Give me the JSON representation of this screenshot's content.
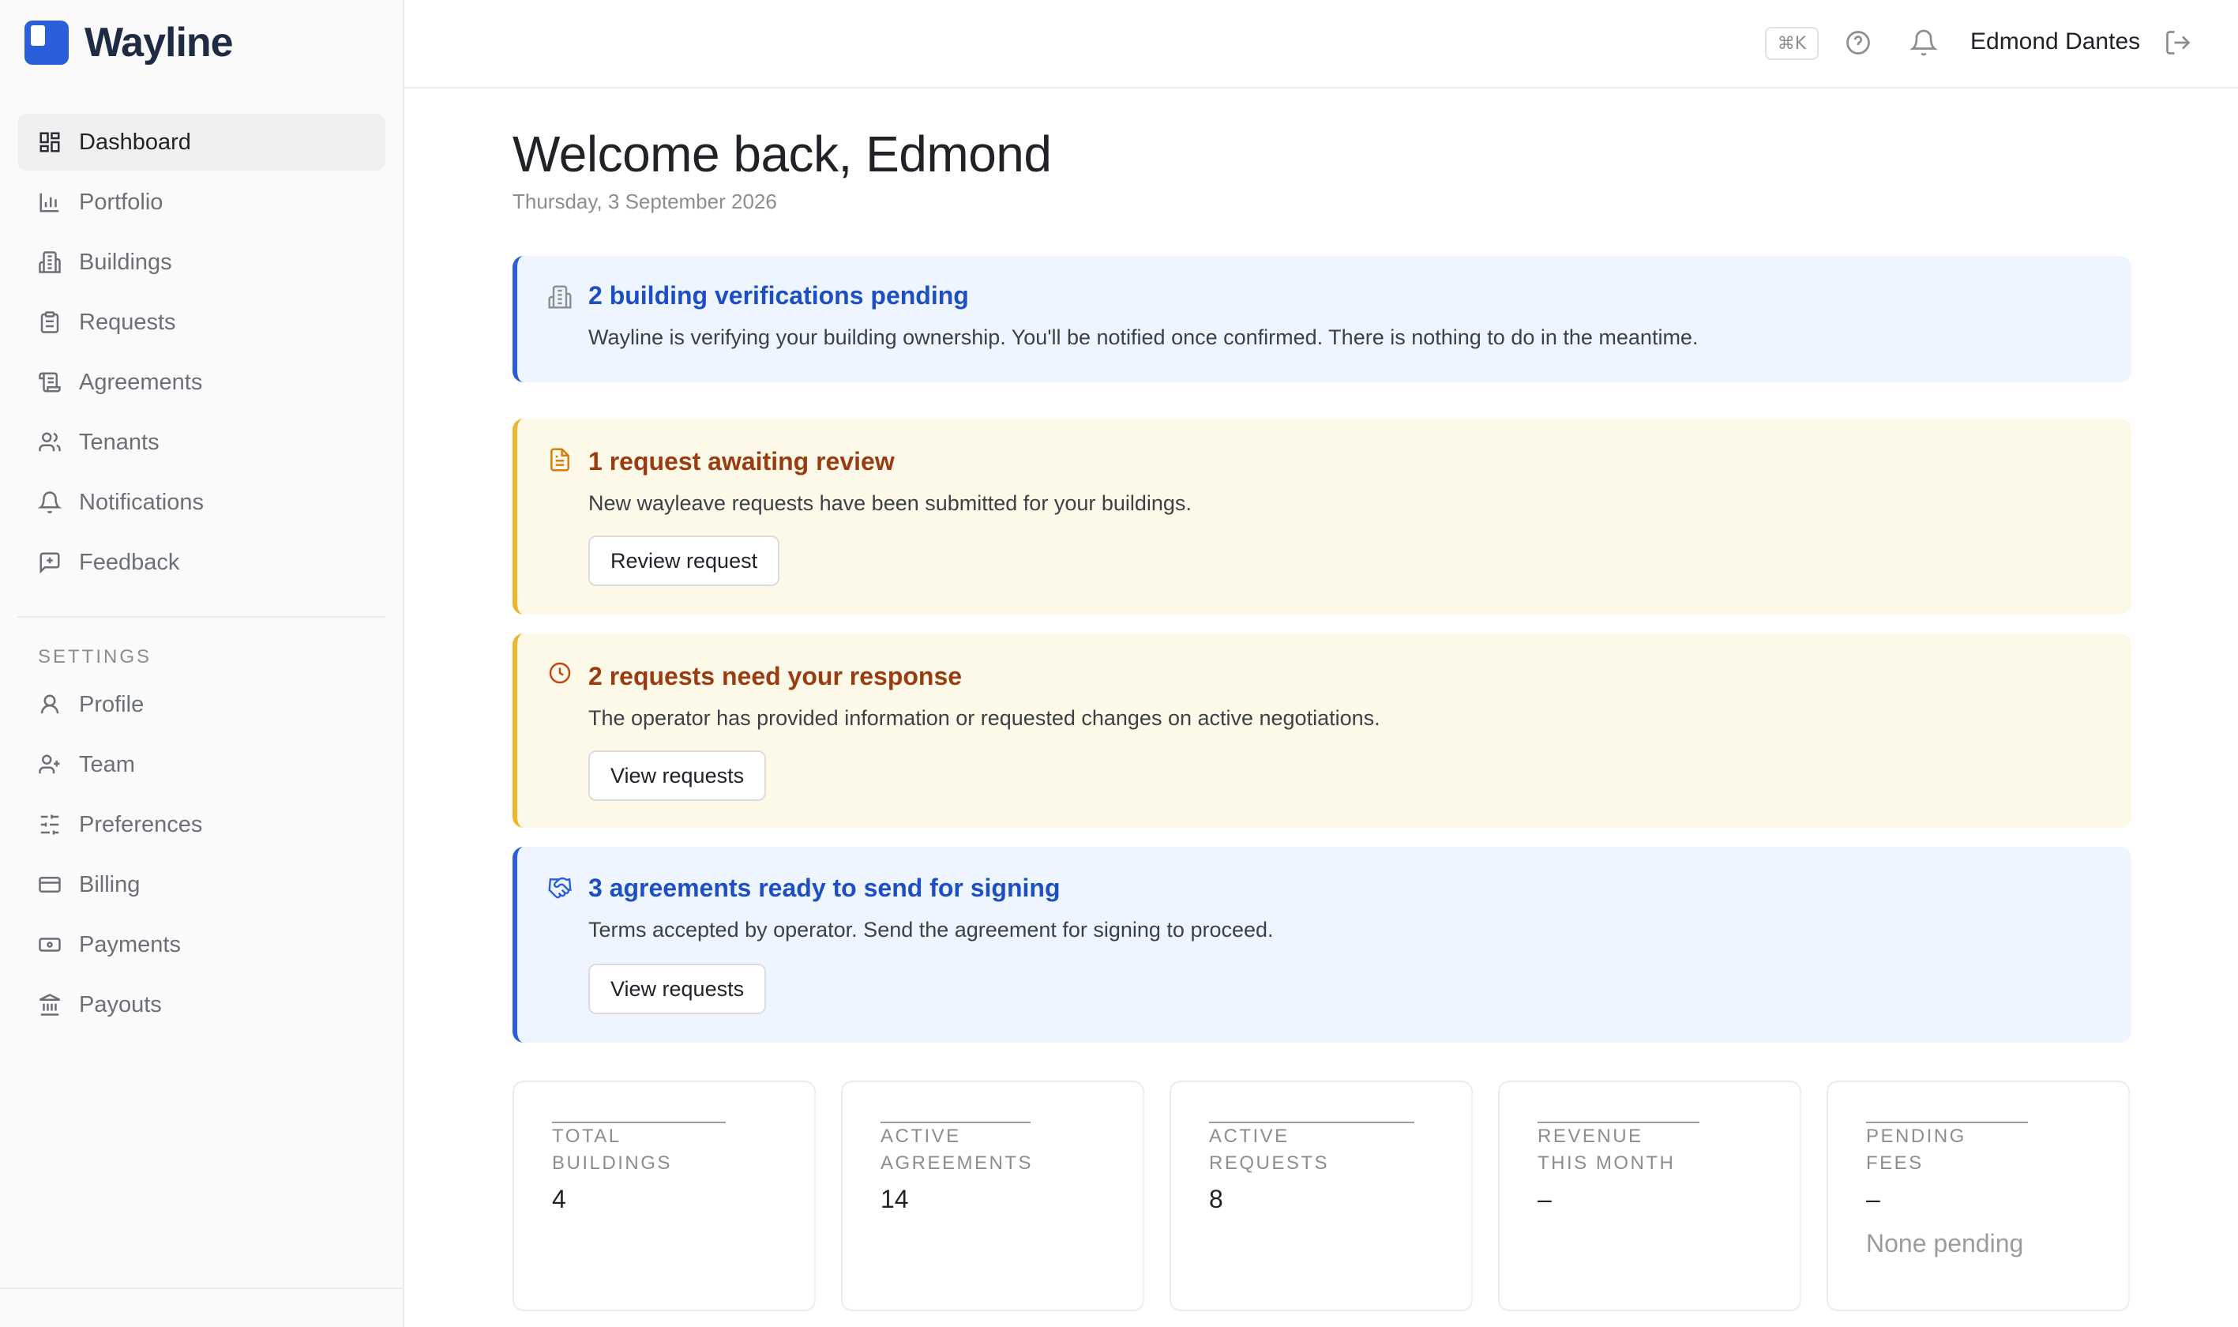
{
  "brand": {
    "name": "Wayline",
    "color": "#2b5fd9"
  },
  "sidebar": {
    "items": [
      {
        "label": "Dashboard",
        "icon": "dashboard-icon",
        "active": true
      },
      {
        "label": "Portfolio",
        "icon": "bar-chart-icon"
      },
      {
        "label": "Buildings",
        "icon": "building-icon"
      },
      {
        "label": "Requests",
        "icon": "clipboard-icon"
      },
      {
        "label": "Agreements",
        "icon": "scroll-icon"
      },
      {
        "label": "Tenants",
        "icon": "users-icon"
      },
      {
        "label": "Notifications",
        "icon": "bell-icon"
      },
      {
        "label": "Feedback",
        "icon": "message-plus-icon"
      }
    ],
    "settings_title": "SETTINGS",
    "settings_items": [
      {
        "label": "Profile",
        "icon": "user-icon"
      },
      {
        "label": "Team",
        "icon": "user-plus-icon"
      },
      {
        "label": "Preferences",
        "icon": "sliders-icon"
      },
      {
        "label": "Billing",
        "icon": "credit-card-icon"
      },
      {
        "label": "Payments",
        "icon": "banknote-icon"
      },
      {
        "label": "Payouts",
        "icon": "bank-icon"
      }
    ]
  },
  "header": {
    "shortcut": "⌘K",
    "user_name": "Edmond Dantes"
  },
  "main": {
    "welcome": "Welcome back, Edmond",
    "date": "Thursday, 3 September 2026",
    "alerts": [
      {
        "tone": "blue",
        "icon": "building-icon",
        "title": "2 building verifications pending",
        "text": "Wayline is verifying your building ownership. You'll be notified once confirmed. There is nothing to do in the meantime."
      },
      {
        "tone": "yellow",
        "icon": "document-icon",
        "title": "1 request awaiting review",
        "text": "New wayleave requests have been submitted for your buildings.",
        "button": "Review request"
      },
      {
        "tone": "yellow",
        "icon": "clock-icon",
        "title": "2 requests need your response",
        "text": "The operator has provided information or requested changes on active negotiations.",
        "button": "View requests"
      },
      {
        "tone": "blue",
        "icon": "handshake-icon",
        "title": "3 agreements ready to send for signing",
        "text": "Terms accepted by operator. Send the agreement for signing to proceed.",
        "button": "View requests"
      }
    ],
    "stats": [
      {
        "label": "TOTAL BUILDINGS",
        "value": "4"
      },
      {
        "label": "ACTIVE AGREEMENTS",
        "value": "14"
      },
      {
        "label": "ACTIVE REQUESTS",
        "value": "8"
      },
      {
        "label": "REVENUE THIS MONTH",
        "value": "–"
      },
      {
        "label": "PENDING FEES",
        "value": "–",
        "sub": "None pending"
      }
    ]
  },
  "colors": {
    "blue_title": "#1d4fc4",
    "blue_bg": "#eef5fe",
    "yellow_title": "#9a3c12",
    "yellow_bg": "#fdf9e8",
    "yellow_border": "#f0b429"
  }
}
